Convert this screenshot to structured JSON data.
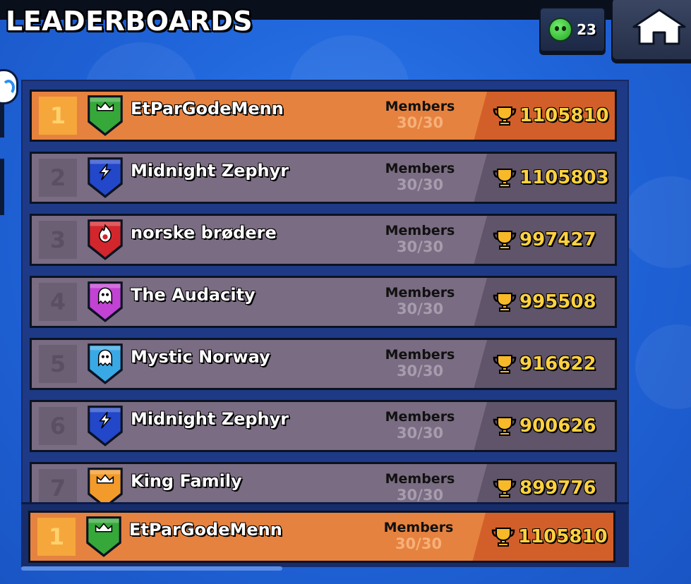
{
  "header": {
    "title": "LEADERBOARDS"
  },
  "tokens": {
    "icon": "green-skull-token-icon",
    "count": "23"
  },
  "home": {
    "icon": "home-icon"
  },
  "columns": {
    "members_label": "Members"
  },
  "rows": [
    {
      "rank": "1",
      "name": "EtParGodeMenn",
      "members": "30/30",
      "trophies": "1105810",
      "badge": "crown",
      "badge_color": "#36a83a",
      "highlight": true
    },
    {
      "rank": "2",
      "name": "Midnight Zephyr",
      "members": "30/30",
      "trophies": "1105803",
      "badge": "bolt",
      "badge_color": "#2247c9",
      "highlight": false
    },
    {
      "rank": "3",
      "name": "norske brødere",
      "members": "30/30",
      "trophies": "997427",
      "badge": "flame",
      "badge_color": "#d3262c",
      "highlight": false
    },
    {
      "rank": "4",
      "name": "The Audacity",
      "members": "30/30",
      "trophies": "995508",
      "badge": "ghost",
      "badge_color": "#c242d3",
      "highlight": false
    },
    {
      "rank": "5",
      "name": "Mystic Norway",
      "members": "30/30",
      "trophies": "916622",
      "badge": "ghost",
      "badge_color": "#39a9e6",
      "highlight": false
    },
    {
      "rank": "6",
      "name": "Midnight Zephyr",
      "members": "30/30",
      "trophies": "900626",
      "badge": "bolt",
      "badge_color": "#2247c9",
      "highlight": false
    },
    {
      "rank": "7",
      "name": "King Family",
      "members": "30/30",
      "trophies": "899776",
      "badge": "crown",
      "badge_color": "#f29a2a",
      "highlight": false
    }
  ],
  "pinned": {
    "rank": "1",
    "name": "EtParGodeMenn",
    "members": "30/30",
    "trophies": "1105810",
    "badge": "crown",
    "badge_color": "#36a83a",
    "highlight": true
  },
  "colors": {
    "highlight": "#e6823f",
    "row": "#7a6c82",
    "trophy_text": "#ffd23f",
    "background": "#2f7cf0"
  }
}
